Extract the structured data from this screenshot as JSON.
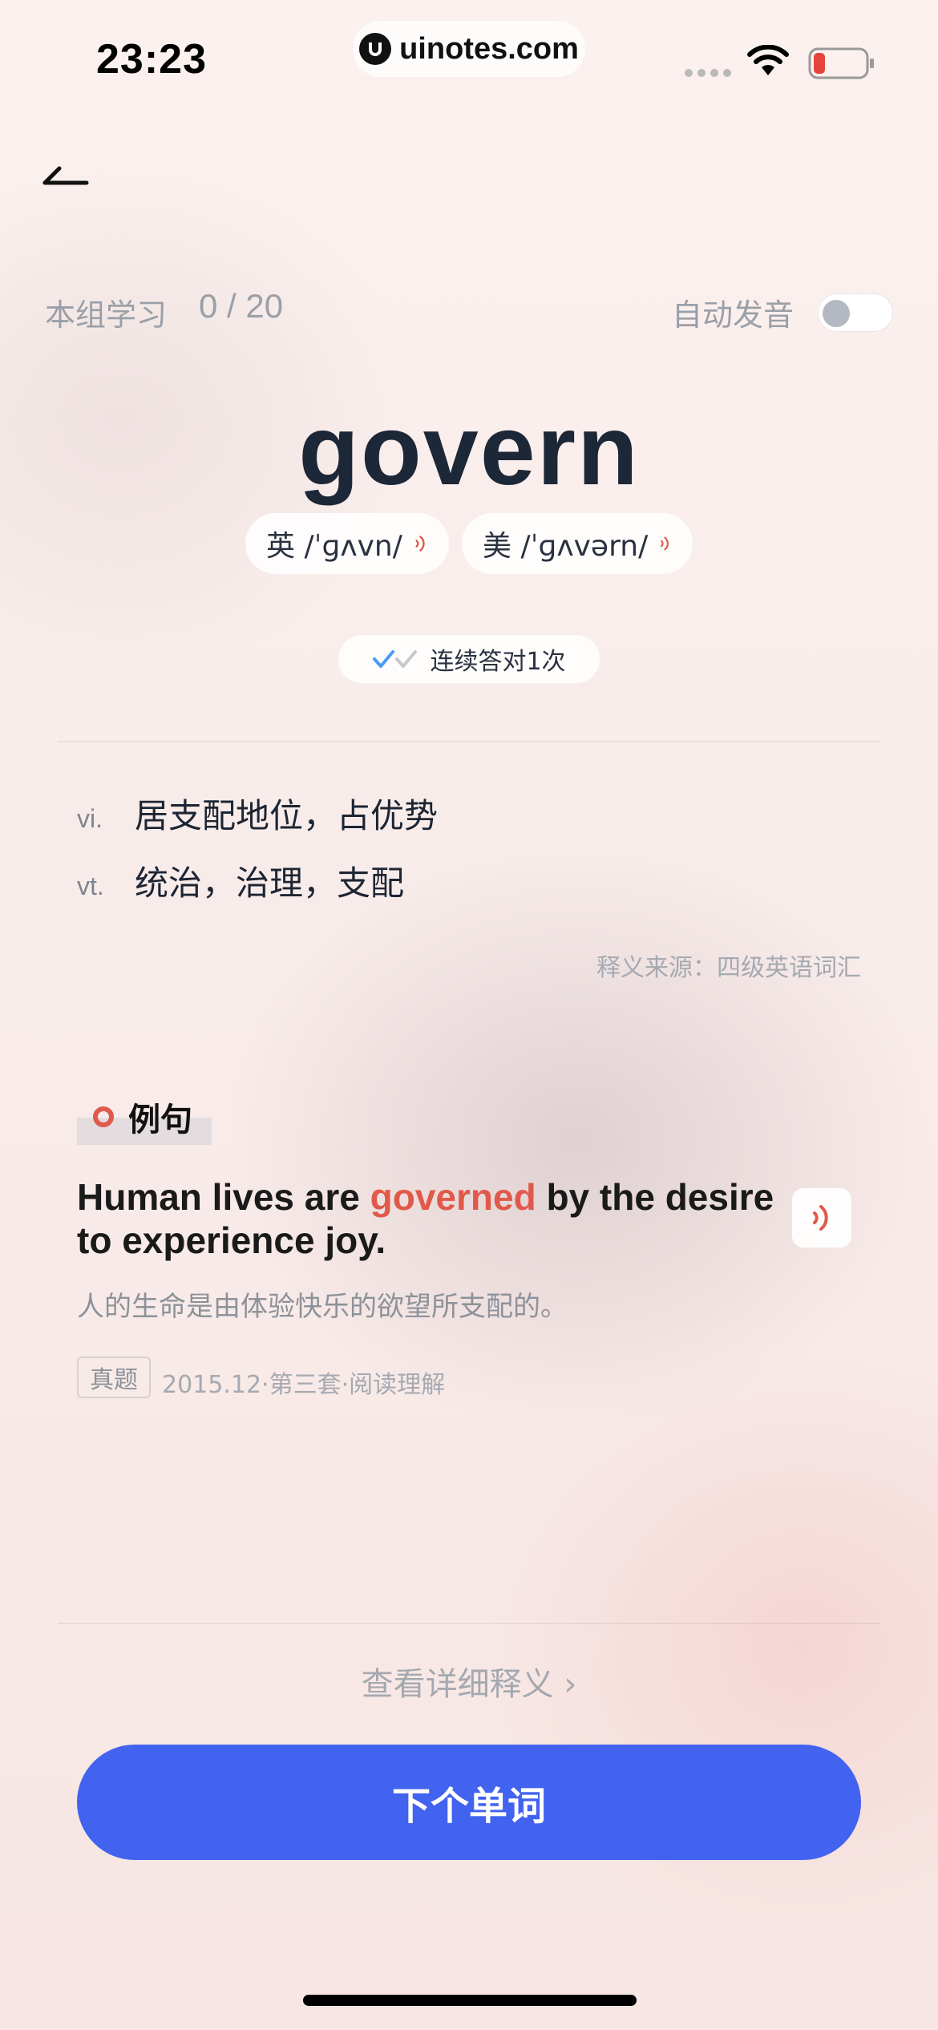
{
  "status_bar": {
    "time": "23:23",
    "watermark": "uinotes.com",
    "icons": [
      "signal-icon",
      "wifi-icon",
      "battery-icon"
    ]
  },
  "nav": {
    "back_icon": "back-arrow-icon"
  },
  "progress": {
    "label": "本组学习",
    "count": "0 / 20",
    "auto_pronounce_label": "自动发音",
    "auto_pronounce_on": false
  },
  "word": {
    "text": "govern",
    "uk": "英 /ˈɡʌvn/",
    "us": "美 /ˈɡʌvərn/"
  },
  "streak": {
    "text": "连续答对1次"
  },
  "definitions": [
    {
      "pos": "vi.",
      "meaning": "居支配地位，占优势"
    },
    {
      "pos": "vt.",
      "meaning": "统治，治理，支配"
    }
  ],
  "definition_source": "释义来源：四级英语词汇",
  "example": {
    "section_title": "例句",
    "sentence_before": "Human lives are ",
    "sentence_highlight": "governed",
    "sentence_after": " by the desire to experience joy.",
    "translation": "人的生命是由体验快乐的欲望所支配的。",
    "tag": "真题",
    "source": "2015.12·第三套·阅读理解"
  },
  "footer": {
    "detail_link": "查看详细释义 ›",
    "next_button": "下个单词"
  },
  "colors": {
    "accent": "#4262f0",
    "highlight": "#e0594a",
    "speaker": "#e0594a",
    "check_blue": "#4a9cf2"
  }
}
